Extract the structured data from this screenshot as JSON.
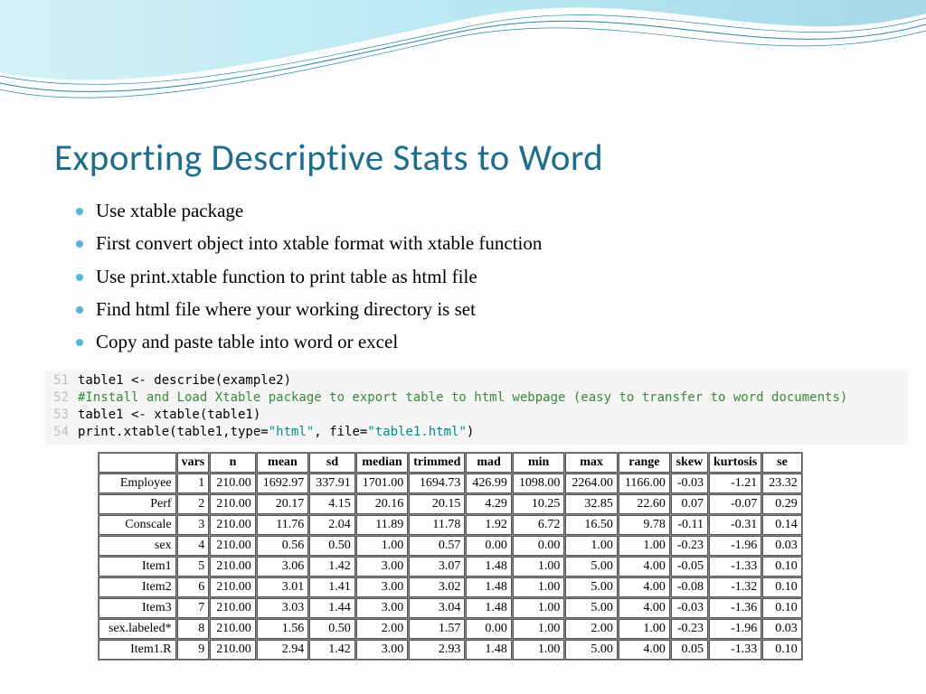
{
  "title": "Exporting Descriptive Stats to Word",
  "bullets": [
    "Use xtable package",
    "First convert object into xtable format with xtable function",
    "Use print.xtable function to print table as html file",
    "Find html file where your working directory is set",
    "Copy and paste table into word or excel"
  ],
  "code": {
    "ln51": "51",
    "ln52": "52",
    "ln53": "53",
    "ln54": "54",
    "l51": "table1 <- describe(example2)",
    "l52": "#Install and Load Xtable package to export table to html webpage (easy to transfer to word documents)",
    "l53": "table1 <- xtable(table1)",
    "l54a": "print.xtable(table1,type=",
    "l54b": "\"html\"",
    "l54c": ", file=",
    "l54d": "\"table1.html\"",
    "l54e": ")"
  },
  "headers": [
    "vars",
    "n",
    "mean",
    "sd",
    "median",
    "trimmed",
    "mad",
    "min",
    "max",
    "range",
    "skew",
    "kurtosis",
    "se"
  ],
  "rows": [
    {
      "label": "Employee",
      "vars": "1",
      "n": "210.00",
      "mean": "1692.97",
      "sd": "337.91",
      "median": "1701.00",
      "trimmed": "1694.73",
      "mad": "426.99",
      "min": "1098.00",
      "max": "2264.00",
      "range": "1166.00",
      "skew": "-0.03",
      "kurtosis": "-1.21",
      "se": "23.32"
    },
    {
      "label": "Perf",
      "vars": "2",
      "n": "210.00",
      "mean": "20.17",
      "sd": "4.15",
      "median": "20.16",
      "trimmed": "20.15",
      "mad": "4.29",
      "min": "10.25",
      "max": "32.85",
      "range": "22.60",
      "skew": "0.07",
      "kurtosis": "-0.07",
      "se": "0.29"
    },
    {
      "label": "Conscale",
      "vars": "3",
      "n": "210.00",
      "mean": "11.76",
      "sd": "2.04",
      "median": "11.89",
      "trimmed": "11.78",
      "mad": "1.92",
      "min": "6.72",
      "max": "16.50",
      "range": "9.78",
      "skew": "-0.11",
      "kurtosis": "-0.31",
      "se": "0.14"
    },
    {
      "label": "sex",
      "vars": "4",
      "n": "210.00",
      "mean": "0.56",
      "sd": "0.50",
      "median": "1.00",
      "trimmed": "0.57",
      "mad": "0.00",
      "min": "0.00",
      "max": "1.00",
      "range": "1.00",
      "skew": "-0.23",
      "kurtosis": "-1.96",
      "se": "0.03"
    },
    {
      "label": "Item1",
      "vars": "5",
      "n": "210.00",
      "mean": "3.06",
      "sd": "1.42",
      "median": "3.00",
      "trimmed": "3.07",
      "mad": "1.48",
      "min": "1.00",
      "max": "5.00",
      "range": "4.00",
      "skew": "-0.05",
      "kurtosis": "-1.33",
      "se": "0.10"
    },
    {
      "label": "Item2",
      "vars": "6",
      "n": "210.00",
      "mean": "3.01",
      "sd": "1.41",
      "median": "3.00",
      "trimmed": "3.02",
      "mad": "1.48",
      "min": "1.00",
      "max": "5.00",
      "range": "4.00",
      "skew": "-0.08",
      "kurtosis": "-1.32",
      "se": "0.10"
    },
    {
      "label": "Item3",
      "vars": "7",
      "n": "210.00",
      "mean": "3.03",
      "sd": "1.44",
      "median": "3.00",
      "trimmed": "3.04",
      "mad": "1.48",
      "min": "1.00",
      "max": "5.00",
      "range": "4.00",
      "skew": "-0.03",
      "kurtosis": "-1.36",
      "se": "0.10"
    },
    {
      "label": "sex.labeled*",
      "vars": "8",
      "n": "210.00",
      "mean": "1.56",
      "sd": "0.50",
      "median": "2.00",
      "trimmed": "1.57",
      "mad": "0.00",
      "min": "1.00",
      "max": "2.00",
      "range": "1.00",
      "skew": "-0.23",
      "kurtosis": "-1.96",
      "se": "0.03"
    },
    {
      "label": "Item1.R",
      "vars": "9",
      "n": "210.00",
      "mean": "2.94",
      "sd": "1.42",
      "median": "3.00",
      "trimmed": "2.93",
      "mad": "1.48",
      "min": "1.00",
      "max": "5.00",
      "range": "4.00",
      "skew": "0.05",
      "kurtosis": "-1.33",
      "se": "0.10"
    }
  ]
}
